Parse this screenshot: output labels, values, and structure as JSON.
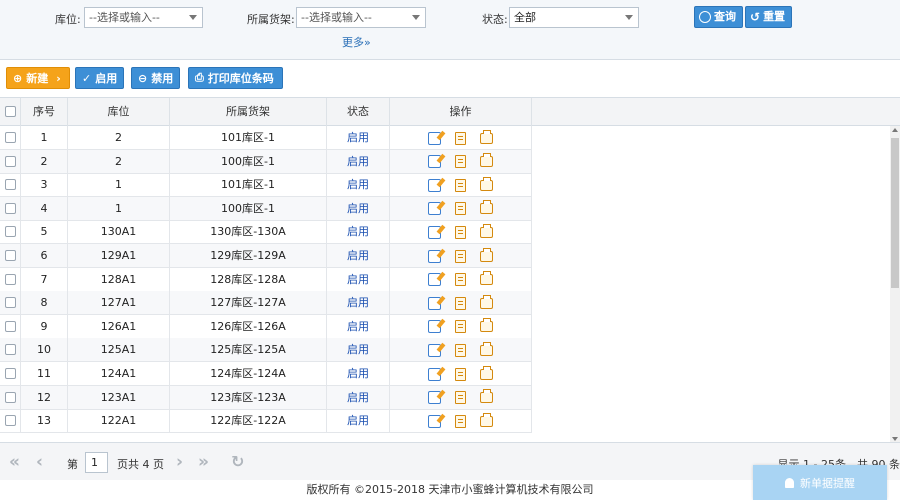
{
  "filters": {
    "location_label": "库位:",
    "location_placeholder": "--选择或输入--",
    "shelf_label": "所属货架:",
    "shelf_placeholder": "--选择或输入--",
    "status_label": "状态:",
    "status_value": "全部",
    "query_button": "查询",
    "reset_button": "重置",
    "more": "更多"
  },
  "toolbar": {
    "new": "新建",
    "enable": "启用",
    "disable": "禁用",
    "print": "打印库位条码"
  },
  "table": {
    "headers": [
      "序号",
      "库位",
      "所属货架",
      "状态",
      "操作"
    ],
    "rows": [
      {
        "no": "1",
        "loc": "2",
        "shelf": "101库区-1",
        "state": "启用"
      },
      {
        "no": "2",
        "loc": "2",
        "shelf": "100库区-1",
        "state": "启用"
      },
      {
        "no": "3",
        "loc": "1",
        "shelf": "101库区-1",
        "state": "启用"
      },
      {
        "no": "4",
        "loc": "1",
        "shelf": "100库区-1",
        "state": "启用"
      },
      {
        "no": "5",
        "loc": "130A1",
        "shelf": "130库区-130A",
        "state": "启用"
      },
      {
        "no": "6",
        "loc": "129A1",
        "shelf": "129库区-129A",
        "state": "启用"
      },
      {
        "no": "7",
        "loc": "128A1",
        "shelf": "128库区-128A",
        "state": "启用"
      },
      {
        "no": "8",
        "loc": "127A1",
        "shelf": "127库区-127A",
        "state": "启用"
      },
      {
        "no": "9",
        "loc": "126A1",
        "shelf": "126库区-126A",
        "state": "启用"
      },
      {
        "no": "10",
        "loc": "125A1",
        "shelf": "125库区-125A",
        "state": "启用"
      },
      {
        "no": "11",
        "loc": "124A1",
        "shelf": "124库区-124A",
        "state": "启用"
      },
      {
        "no": "12",
        "loc": "123A1",
        "shelf": "123库区-123A",
        "state": "启用"
      },
      {
        "no": "13",
        "loc": "122A1",
        "shelf": "122库区-122A",
        "state": "启用"
      }
    ]
  },
  "pager": {
    "page_prefix": "第",
    "page_value": "1",
    "page_suffix": "页共 4 页",
    "summary": "显示 1 - 25条，共 90 条"
  },
  "footer": "版权所有 ©2015-2018 天津市小蜜蜂计算机技术有限公司",
  "notice": "新单据提醒",
  "colors": {
    "accent": "#3d8fd6",
    "new_button": "#f5a31a",
    "status_link": "#1a4fb0"
  }
}
